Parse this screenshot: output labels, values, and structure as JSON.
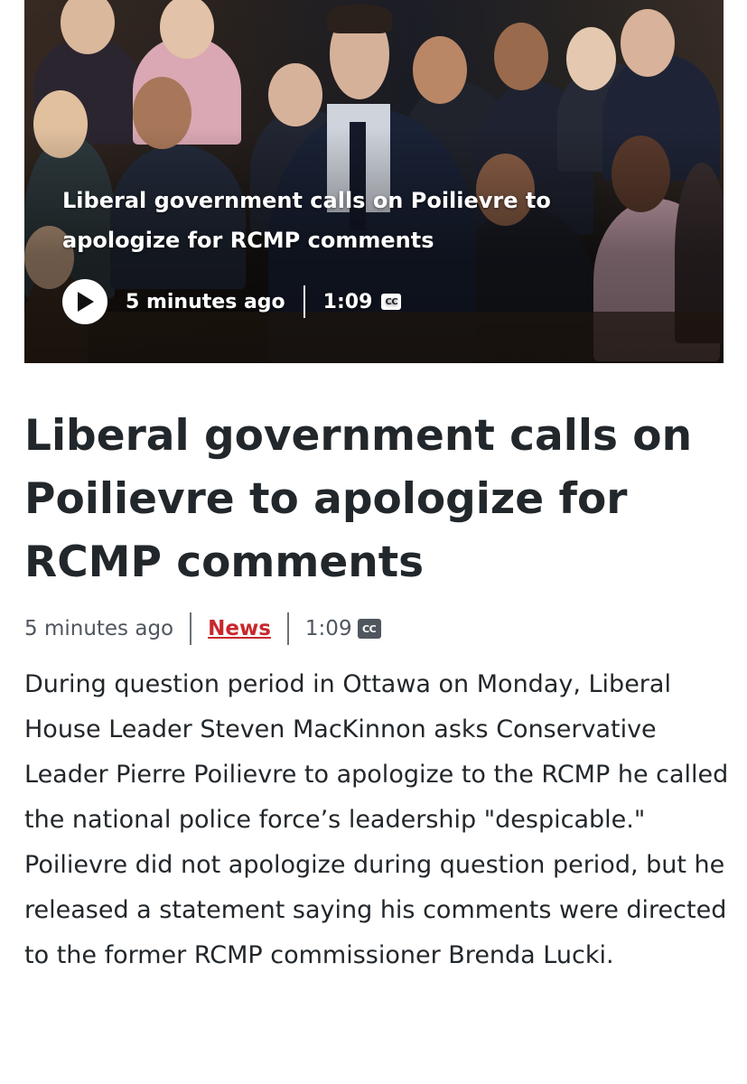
{
  "hero": {
    "title": "Liberal government calls on Poilievre to apologize for RCMP comments",
    "timestamp": "5 minutes ago",
    "duration": "1:09",
    "cc_label": "CC",
    "play_icon": "play-icon"
  },
  "article": {
    "headline": "Liberal government calls on Poilievre to apologize for RCMP comments",
    "timestamp": "5 minutes ago",
    "category": "News",
    "duration": "1:09",
    "cc_label": "CC",
    "body": "During question period in Ottawa on Monday, Liberal House Leader Steven MacKinnon asks Conservative Leader Pierre Poilievre to apologize to the RCMP he called the national police force’s leadership \"despicable.\" Poilievre did not apologize during question period, but he released a statement saying his comments were directed to the former RCMP commissioner Brenda Lucki."
  },
  "colors": {
    "headline": "#22272b",
    "meta": "#4f565e",
    "link": "#c8282d"
  }
}
